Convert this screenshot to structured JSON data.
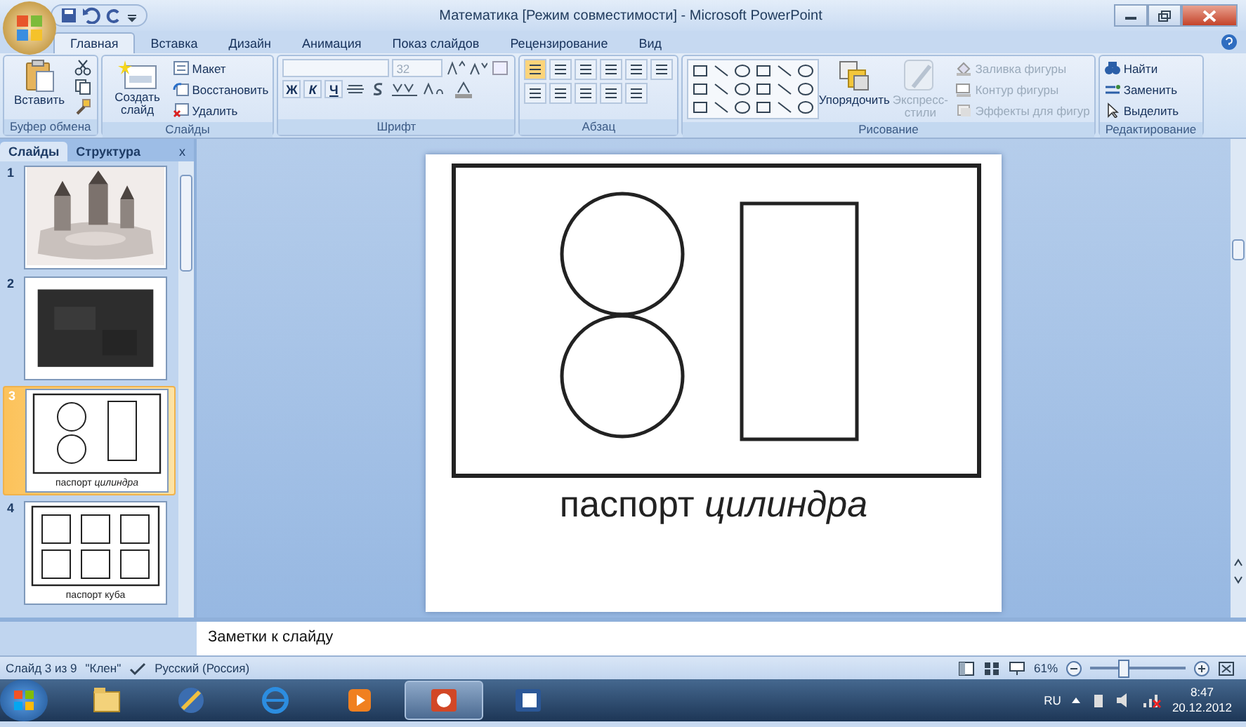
{
  "window": {
    "title": "Математика [Режим совместимости] - Microsoft PowerPoint"
  },
  "tabs": [
    {
      "label": "Главная",
      "selected": true
    },
    {
      "label": "Вставка",
      "selected": false
    },
    {
      "label": "Дизайн",
      "selected": false
    },
    {
      "label": "Анимация",
      "selected": false
    },
    {
      "label": "Показ слайдов",
      "selected": false
    },
    {
      "label": "Рецензирование",
      "selected": false
    },
    {
      "label": "Вид",
      "selected": false
    }
  ],
  "ribbon": {
    "groups": [
      {
        "label": "Буфер обмена",
        "kind": "clipboard",
        "items": [
          {
            "label": "Вставить",
            "kind": "large",
            "disabled": false
          }
        ]
      },
      {
        "label": "Слайды",
        "kind": "slides",
        "items": [
          {
            "label": "Создать слайд",
            "kind": "large",
            "disabled": false
          },
          {
            "label": "Макет",
            "kind": "small",
            "disabled": false
          },
          {
            "label": "Восстановить",
            "kind": "small",
            "disabled": false
          },
          {
            "label": "Удалить",
            "kind": "small",
            "disabled": false
          }
        ]
      },
      {
        "label": "Шрифт",
        "kind": "font",
        "font_size": "32",
        "format_buttons": [
          "Ж",
          "К",
          "Ч"
        ]
      },
      {
        "label": "Абзац",
        "kind": "paragraph"
      },
      {
        "label": "Рисование",
        "kind": "drawing",
        "items": [
          {
            "label": "Упорядочить",
            "kind": "large",
            "disabled": false
          },
          {
            "label": "Экспресс-стили",
            "kind": "large",
            "disabled": true
          },
          {
            "label": "Заливка фигуры",
            "kind": "small",
            "disabled": true
          },
          {
            "label": "Контур фигуры",
            "kind": "small",
            "disabled": true
          },
          {
            "label": "Эффекты для фигур",
            "kind": "small",
            "disabled": true
          }
        ]
      },
      {
        "label": "Редактирование",
        "kind": "editing",
        "items": [
          {
            "label": "Найти",
            "kind": "small",
            "disabled": false
          },
          {
            "label": "Заменить",
            "kind": "small",
            "disabled": false
          },
          {
            "label": "Выделить",
            "kind": "small",
            "disabled": false
          }
        ]
      }
    ]
  },
  "panel": {
    "tabs": [
      {
        "label": "Слайды",
        "selected": true
      },
      {
        "label": "Структура",
        "selected": false
      }
    ],
    "close": "x",
    "slides": [
      {
        "number": "1",
        "kind": "picture",
        "selected": false
      },
      {
        "number": "2",
        "kind": "dark-picture",
        "selected": false
      },
      {
        "number": "3",
        "kind": "cylinder",
        "caption": "паспорт *цилиндра*",
        "selected": true
      },
      {
        "number": "4",
        "kind": "cube",
        "caption": "паспорт куба",
        "selected": false
      }
    ]
  },
  "slide": {
    "caption": "паспорт *цилиндра*"
  },
  "notes": {
    "placeholder": "Заметки к слайду"
  },
  "status_bar": {
    "slide": "Слайд 3 из 9",
    "theme": "\"Клен\"",
    "language": "Русский (Россия)",
    "zoom": "61%",
    "zoom_slider": {
      "level": 0.35
    }
  },
  "taskbar": {
    "apps": [
      {
        "kind": "folder",
        "selected": false
      },
      {
        "kind": "tool",
        "selected": false
      },
      {
        "kind": "browser",
        "selected": false
      },
      {
        "kind": "player",
        "selected": false
      },
      {
        "kind": "powerpoint",
        "selected": true
      },
      {
        "kind": "word",
        "selected": false
      }
    ],
    "language": "RU",
    "time": "8:47",
    "date": "20.12.2012"
  }
}
